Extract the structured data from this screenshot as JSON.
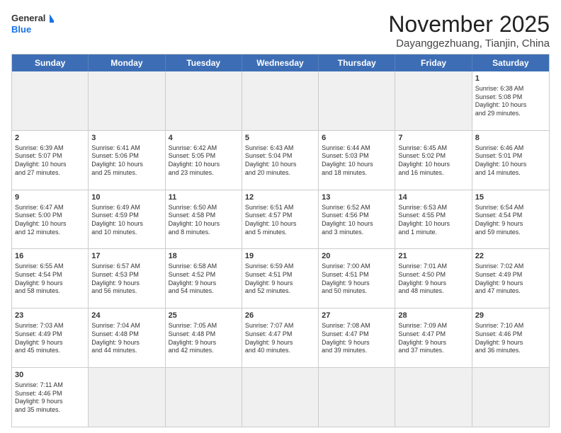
{
  "logo": {
    "text_general": "General",
    "text_blue": "Blue"
  },
  "title": "November 2025",
  "subtitle": "Dayanggezhuang, Tianjin, China",
  "days": [
    "Sunday",
    "Monday",
    "Tuesday",
    "Wednesday",
    "Thursday",
    "Friday",
    "Saturday"
  ],
  "rows": [
    [
      {
        "day": "",
        "empty": true,
        "lines": []
      },
      {
        "day": "",
        "empty": true,
        "lines": []
      },
      {
        "day": "",
        "empty": true,
        "lines": []
      },
      {
        "day": "",
        "empty": true,
        "lines": []
      },
      {
        "day": "",
        "empty": true,
        "lines": []
      },
      {
        "day": "",
        "empty": true,
        "lines": []
      },
      {
        "day": "1",
        "empty": false,
        "lines": [
          "Sunrise: 6:38 AM",
          "Sunset: 5:08 PM",
          "Daylight: 10 hours",
          "and 29 minutes."
        ]
      }
    ],
    [
      {
        "day": "2",
        "empty": false,
        "lines": [
          "Sunrise: 6:39 AM",
          "Sunset: 5:07 PM",
          "Daylight: 10 hours",
          "and 27 minutes."
        ]
      },
      {
        "day": "3",
        "empty": false,
        "lines": [
          "Sunrise: 6:41 AM",
          "Sunset: 5:06 PM",
          "Daylight: 10 hours",
          "and 25 minutes."
        ]
      },
      {
        "day": "4",
        "empty": false,
        "lines": [
          "Sunrise: 6:42 AM",
          "Sunset: 5:05 PM",
          "Daylight: 10 hours",
          "and 23 minutes."
        ]
      },
      {
        "day": "5",
        "empty": false,
        "lines": [
          "Sunrise: 6:43 AM",
          "Sunset: 5:04 PM",
          "Daylight: 10 hours",
          "and 20 minutes."
        ]
      },
      {
        "day": "6",
        "empty": false,
        "lines": [
          "Sunrise: 6:44 AM",
          "Sunset: 5:03 PM",
          "Daylight: 10 hours",
          "and 18 minutes."
        ]
      },
      {
        "day": "7",
        "empty": false,
        "lines": [
          "Sunrise: 6:45 AM",
          "Sunset: 5:02 PM",
          "Daylight: 10 hours",
          "and 16 minutes."
        ]
      },
      {
        "day": "8",
        "empty": false,
        "lines": [
          "Sunrise: 6:46 AM",
          "Sunset: 5:01 PM",
          "Daylight: 10 hours",
          "and 14 minutes."
        ]
      }
    ],
    [
      {
        "day": "9",
        "empty": false,
        "lines": [
          "Sunrise: 6:47 AM",
          "Sunset: 5:00 PM",
          "Daylight: 10 hours",
          "and 12 minutes."
        ]
      },
      {
        "day": "10",
        "empty": false,
        "lines": [
          "Sunrise: 6:49 AM",
          "Sunset: 4:59 PM",
          "Daylight: 10 hours",
          "and 10 minutes."
        ]
      },
      {
        "day": "11",
        "empty": false,
        "lines": [
          "Sunrise: 6:50 AM",
          "Sunset: 4:58 PM",
          "Daylight: 10 hours",
          "and 8 minutes."
        ]
      },
      {
        "day": "12",
        "empty": false,
        "lines": [
          "Sunrise: 6:51 AM",
          "Sunset: 4:57 PM",
          "Daylight: 10 hours",
          "and 5 minutes."
        ]
      },
      {
        "day": "13",
        "empty": false,
        "lines": [
          "Sunrise: 6:52 AM",
          "Sunset: 4:56 PM",
          "Daylight: 10 hours",
          "and 3 minutes."
        ]
      },
      {
        "day": "14",
        "empty": false,
        "lines": [
          "Sunrise: 6:53 AM",
          "Sunset: 4:55 PM",
          "Daylight: 10 hours",
          "and 1 minute."
        ]
      },
      {
        "day": "15",
        "empty": false,
        "lines": [
          "Sunrise: 6:54 AM",
          "Sunset: 4:54 PM",
          "Daylight: 9 hours",
          "and 59 minutes."
        ]
      }
    ],
    [
      {
        "day": "16",
        "empty": false,
        "lines": [
          "Sunrise: 6:55 AM",
          "Sunset: 4:54 PM",
          "Daylight: 9 hours",
          "and 58 minutes."
        ]
      },
      {
        "day": "17",
        "empty": false,
        "lines": [
          "Sunrise: 6:57 AM",
          "Sunset: 4:53 PM",
          "Daylight: 9 hours",
          "and 56 minutes."
        ]
      },
      {
        "day": "18",
        "empty": false,
        "lines": [
          "Sunrise: 6:58 AM",
          "Sunset: 4:52 PM",
          "Daylight: 9 hours",
          "and 54 minutes."
        ]
      },
      {
        "day": "19",
        "empty": false,
        "lines": [
          "Sunrise: 6:59 AM",
          "Sunset: 4:51 PM",
          "Daylight: 9 hours",
          "and 52 minutes."
        ]
      },
      {
        "day": "20",
        "empty": false,
        "lines": [
          "Sunrise: 7:00 AM",
          "Sunset: 4:51 PM",
          "Daylight: 9 hours",
          "and 50 minutes."
        ]
      },
      {
        "day": "21",
        "empty": false,
        "lines": [
          "Sunrise: 7:01 AM",
          "Sunset: 4:50 PM",
          "Daylight: 9 hours",
          "and 48 minutes."
        ]
      },
      {
        "day": "22",
        "empty": false,
        "lines": [
          "Sunrise: 7:02 AM",
          "Sunset: 4:49 PM",
          "Daylight: 9 hours",
          "and 47 minutes."
        ]
      }
    ],
    [
      {
        "day": "23",
        "empty": false,
        "lines": [
          "Sunrise: 7:03 AM",
          "Sunset: 4:49 PM",
          "Daylight: 9 hours",
          "and 45 minutes."
        ]
      },
      {
        "day": "24",
        "empty": false,
        "lines": [
          "Sunrise: 7:04 AM",
          "Sunset: 4:48 PM",
          "Daylight: 9 hours",
          "and 44 minutes."
        ]
      },
      {
        "day": "25",
        "empty": false,
        "lines": [
          "Sunrise: 7:05 AM",
          "Sunset: 4:48 PM",
          "Daylight: 9 hours",
          "and 42 minutes."
        ]
      },
      {
        "day": "26",
        "empty": false,
        "lines": [
          "Sunrise: 7:07 AM",
          "Sunset: 4:47 PM",
          "Daylight: 9 hours",
          "and 40 minutes."
        ]
      },
      {
        "day": "27",
        "empty": false,
        "lines": [
          "Sunrise: 7:08 AM",
          "Sunset: 4:47 PM",
          "Daylight: 9 hours",
          "and 39 minutes."
        ]
      },
      {
        "day": "28",
        "empty": false,
        "lines": [
          "Sunrise: 7:09 AM",
          "Sunset: 4:47 PM",
          "Daylight: 9 hours",
          "and 37 minutes."
        ]
      },
      {
        "day": "29",
        "empty": false,
        "lines": [
          "Sunrise: 7:10 AM",
          "Sunset: 4:46 PM",
          "Daylight: 9 hours",
          "and 36 minutes."
        ]
      }
    ],
    [
      {
        "day": "30",
        "empty": false,
        "lines": [
          "Sunrise: 7:11 AM",
          "Sunset: 4:46 PM",
          "Daylight: 9 hours",
          "and 35 minutes."
        ]
      },
      {
        "day": "",
        "empty": true,
        "lines": []
      },
      {
        "day": "",
        "empty": true,
        "lines": []
      },
      {
        "day": "",
        "empty": true,
        "lines": []
      },
      {
        "day": "",
        "empty": true,
        "lines": []
      },
      {
        "day": "",
        "empty": true,
        "lines": []
      },
      {
        "day": "",
        "empty": true,
        "lines": []
      }
    ]
  ]
}
